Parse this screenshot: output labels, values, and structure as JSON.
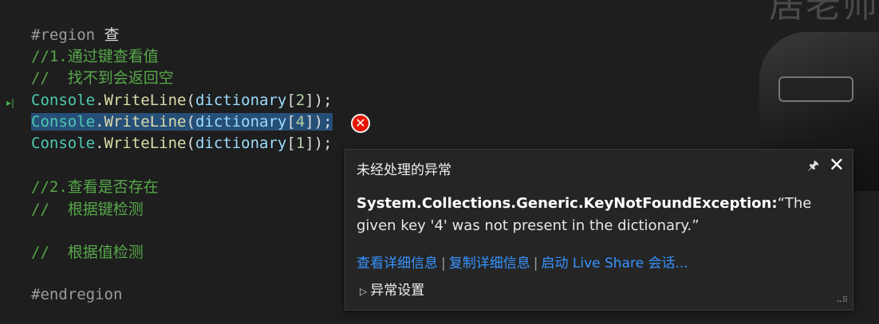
{
  "watermark": "居老师",
  "code": {
    "line1": {
      "kw": "#region",
      "rest": " 查"
    },
    "line2": "//1.通过键查看值",
    "line3": "//  找不到会返回空",
    "line4": {
      "cls": "Console",
      "dot": ".",
      "mth": "WriteLine",
      "open": "(",
      "var": "dictionary",
      "lb": "[",
      "num": "2",
      "rb": "]);"
    },
    "line5": {
      "cls": "Console",
      "dot": ".",
      "mth": "WriteLine",
      "open": "(",
      "var": "dictionary",
      "lb": "[",
      "num": "4",
      "rb": "]);"
    },
    "line6": {
      "cls": "Console",
      "dot": ".",
      "mth": "WriteLine",
      "open": "(",
      "var": "dictionary",
      "lb": "[",
      "num": "1",
      "rb": "]);"
    },
    "line8": "//2.查看是否存在",
    "line9": "//  根据键检测",
    "line11": "//  根据值检测",
    "line13": "#endregion"
  },
  "exception_popup": {
    "title": "未经处理的异常",
    "pin_icon": "pin-icon",
    "close_icon": "close-icon",
    "exception_type": "System.Collections.Generic.KeyNotFoundException:",
    "message": "“The given key '4' was not present in the dictionary.”",
    "links": [
      "查看详细信息",
      "复制详细信息",
      "启动 Live Share 会话..."
    ],
    "separator": "|",
    "settings_label": "异常设置"
  },
  "colors": {
    "error": "#e51400",
    "link": "#3794ff",
    "comment": "#57a64a",
    "class": "#4ec9b0"
  }
}
